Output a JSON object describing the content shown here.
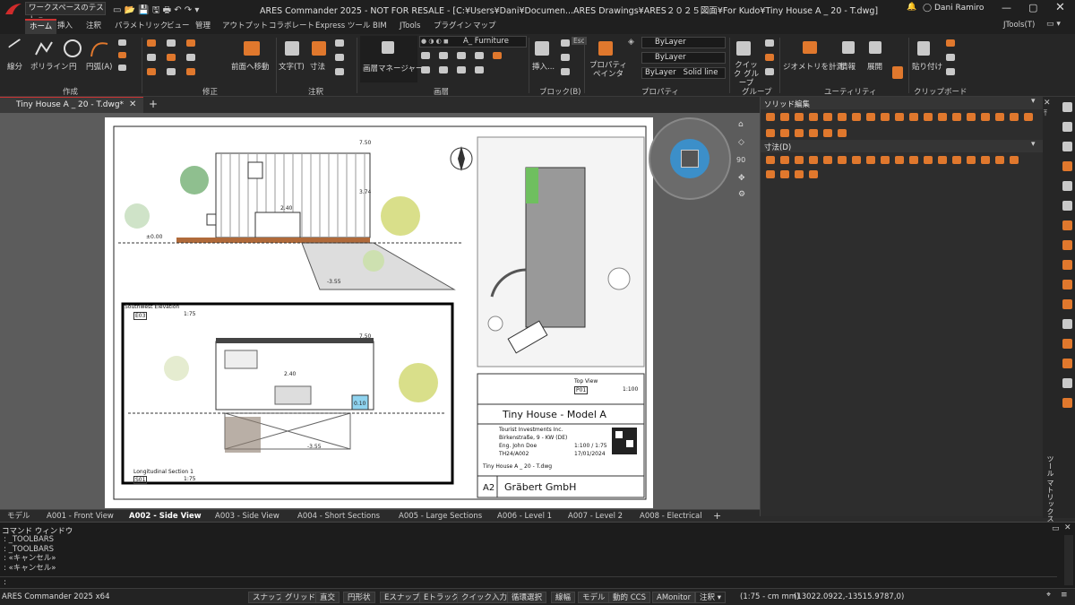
{
  "titlebar": {
    "workspace": "ワークスペースのテスト",
    "title": "ARES Commander 2025 - NOT FOR RESALE - [C:¥Users¥Dani¥Documen...ARES Drawings¥ARES２０２５図面¥For Kudo¥Tiny House A _ 20 - T.dwg]",
    "user": "Dani Ramiro"
  },
  "ribbon_tabs": [
    "ホーム",
    "挿入",
    "注釈",
    "パラメトリック",
    "ビュー",
    "管理",
    "アウトプット",
    "コラボレート",
    "Express ツール",
    "BIM",
    "JTools",
    "プラグイン",
    "マップ"
  ],
  "ribbon_right": "JTools(T)",
  "groups": {
    "draw": {
      "label": "作成",
      "tools": [
        "線分",
        "ポリライン",
        "円",
        "円弧(A)"
      ]
    },
    "modify": {
      "label": "修正",
      "tool": "前面へ移動"
    },
    "annotation": {
      "label": "注釈",
      "tools": [
        "文字(T)",
        "寸法"
      ]
    },
    "layer": {
      "label": "画層",
      "manager": "画層マネージャー",
      "current_layer": "A_ Furniture",
      "hint": "Esc"
    },
    "block": {
      "label": "ブロック(B)",
      "tool": "挿入..."
    },
    "properties": {
      "label": "プロパティ",
      "painter": "プロパティ ペインタ",
      "color": "ByLayer",
      "linetype": "ByLayer",
      "lineweight_a": "ByLayer",
      "lineweight_b": "Solid line"
    },
    "group": {
      "label": "グループ",
      "tool": "クイック グループ"
    },
    "utility": {
      "label": "ユーティリティ",
      "tools": [
        "ジオメトリを計測",
        "情報",
        "展開"
      ]
    },
    "clipboard": {
      "label": "クリップボード",
      "tool": "貼り付け"
    }
  },
  "doc_tab": "Tiny House A _ 20 - T.dwg*",
  "drawing": {
    "title": "Tiny House - Model A",
    "client": "Tourist Investments Inc.",
    "address": "Birkenstraße, 9 - KW (DE)",
    "technician": "Eng. John Doe",
    "scale": "1:100 / 1:75",
    "sheet": "TH24/A002",
    "date": "17/01/2024",
    "file": "Tiny House A _ 20 - T.dwg",
    "company": "Gräbert GmbH",
    "sheet_size": "A2",
    "views": [
      {
        "title": "Southwest Elevation",
        "code": "E03",
        "scale": "1:75"
      },
      {
        "title": "Longitudinal Section 1",
        "code": "S01",
        "scale": "1:75"
      },
      {
        "title": "Top View",
        "code": "P01",
        "scale": "1:100"
      }
    ],
    "dims": [
      "7.50",
      "3.74",
      "2.40",
      "±0.00",
      "-3.55",
      "7.50",
      "2.40",
      "0.10",
      "-3.55"
    ]
  },
  "viewcube": {
    "label": "90"
  },
  "panel": {
    "section1": "ソリッド編集",
    "section2": "寸法(D)",
    "side_label": "ツール マトリックス"
  },
  "layout_tabs": [
    "モデル",
    "A001 - Front View",
    "A002 - Side View",
    "A003 - Side View",
    "A004 - Short Sections",
    "A005 - Large Sections",
    "A006 - Level 1",
    "A007 - Level 2",
    "A008 - Electrical"
  ],
  "active_layout": "A002 - Side View",
  "command": {
    "title": "コマンド ウィンドウ",
    "lines": [
      ": _TOOLBARS",
      ": _TOOLBARS",
      ": «キャンセル»",
      ": «キャンセル»"
    ],
    "prompt": ":"
  },
  "status": {
    "app": "ARES Commander 2025 x64",
    "buttons": [
      "スナップ",
      "グリッド",
      "直交",
      "円形状",
      "Eスナップ",
      "Eトラック",
      "クイック入力",
      "循環選択",
      "線幅",
      "モデル",
      "動的 CCS",
      "AMonitor"
    ],
    "annotation": "注釈",
    "scale": "(1:75 - cm mm)",
    "coords": "(13022.0922,-13515.9787,0)"
  }
}
